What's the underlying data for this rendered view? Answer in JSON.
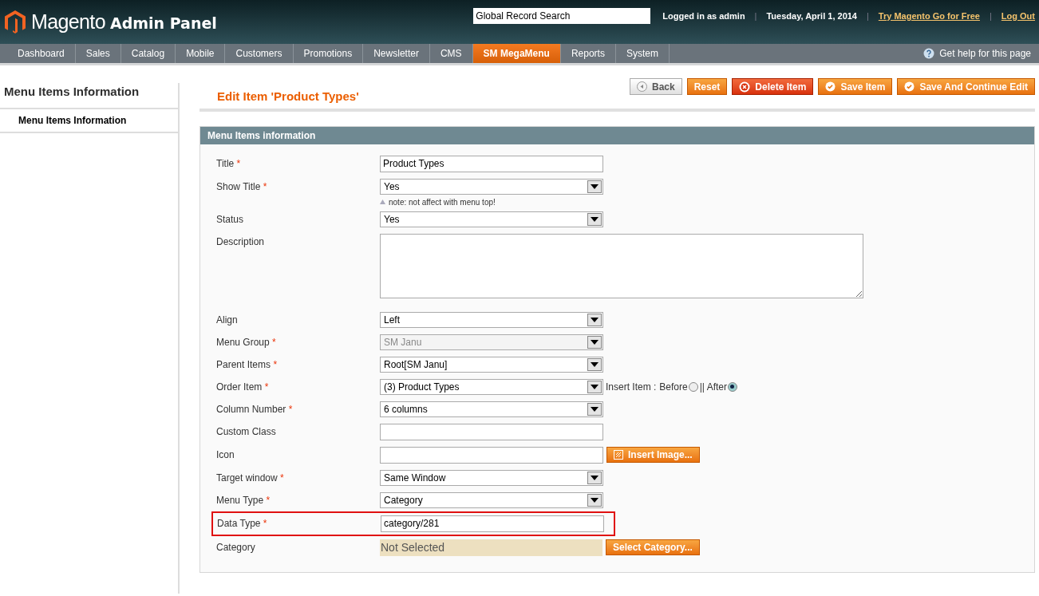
{
  "header": {
    "logo_text": "Magento",
    "logo_suffix": "Admin Panel",
    "search": {
      "value": "Global Record Search"
    },
    "items": [
      {
        "kind": "text",
        "text": "Logged in as admin"
      },
      {
        "kind": "separator",
        "text": "|"
      },
      {
        "kind": "text",
        "text": "Tuesday, April 1, 2014"
      },
      {
        "kind": "separator",
        "text": "|"
      },
      {
        "kind": "link",
        "text": "Try Magento Go for Free"
      },
      {
        "kind": "separator",
        "text": "|"
      },
      {
        "kind": "link",
        "text": "Log Out"
      }
    ]
  },
  "nav": {
    "items": [
      {
        "label": "Dashboard",
        "selected": false
      },
      {
        "label": "Sales",
        "selected": false
      },
      {
        "label": "Catalog",
        "selected": false
      },
      {
        "label": "Mobile",
        "selected": false
      },
      {
        "label": "Customers",
        "selected": false
      },
      {
        "label": "Promotions",
        "selected": false
      },
      {
        "label": "Newsletter",
        "selected": false
      },
      {
        "label": "CMS",
        "selected": false
      },
      {
        "label": "SM MegaMenu",
        "selected": true
      },
      {
        "label": "Reports",
        "selected": false
      },
      {
        "label": "System",
        "selected": false
      }
    ],
    "help": "Get help for this page"
  },
  "sidebar": {
    "title": "Menu Items Information",
    "items": [
      {
        "label": "Menu Items Information",
        "selected": true
      }
    ]
  },
  "page_title": "Edit Item 'Product Types'",
  "actions": [
    {
      "label": "Back",
      "kind": "back"
    },
    {
      "label": "Reset",
      "kind": "plain"
    },
    {
      "label": "Delete Item",
      "kind": "delete"
    },
    {
      "label": "Save Item",
      "kind": "save"
    },
    {
      "label": "Save And Continue Edit",
      "kind": "save"
    }
  ],
  "section_title": "Menu Items information",
  "fields": [
    {
      "label": "Title",
      "required_mark": "*",
      "kind": "text",
      "value": "Product Types"
    },
    {
      "label": "Show Title",
      "required_mark": "*",
      "kind": "select",
      "value": "Yes",
      "note": "note: not affect with menu top!"
    },
    {
      "label": "Status",
      "kind": "select",
      "value": "Yes"
    },
    {
      "label": "Description",
      "kind": "textarea"
    },
    {
      "label": "Align",
      "kind": "select",
      "value": "Left"
    },
    {
      "label": "Menu Group",
      "required_mark": "*",
      "kind": "select",
      "value": "SM Janu",
      "disabled": true
    },
    {
      "label": "Parent Items",
      "required_mark": "*",
      "kind": "select",
      "value": "Root[SM Janu]"
    },
    {
      "label": "Order Item",
      "required_mark": "*",
      "kind": "select",
      "value": "(3) Product Types",
      "extra": {
        "label": "Insert Item :",
        "options": [
          {
            "label": "Before",
            "selected": false
          },
          {
            "label": "|| After",
            "selected": true
          }
        ]
      }
    },
    {
      "label": "Column Number",
      "required_mark": "*",
      "kind": "select",
      "value": "6 columns"
    },
    {
      "label": "Custom Class",
      "kind": "text"
    },
    {
      "label": "Icon",
      "kind": "text",
      "button": "Insert Image..."
    },
    {
      "label": "Target window",
      "required_mark": "*",
      "kind": "select",
      "value": "Same Window"
    },
    {
      "label": "Menu Type",
      "required_mark": "*",
      "kind": "select",
      "value": "Category"
    },
    {
      "label": "Data Type",
      "required_mark": "*",
      "kind": "text",
      "value": "category/281",
      "highlighted": true
    },
    {
      "label": "Category",
      "kind": "chooser",
      "value": "Not Selected",
      "button": "Select Category..."
    }
  ]
}
